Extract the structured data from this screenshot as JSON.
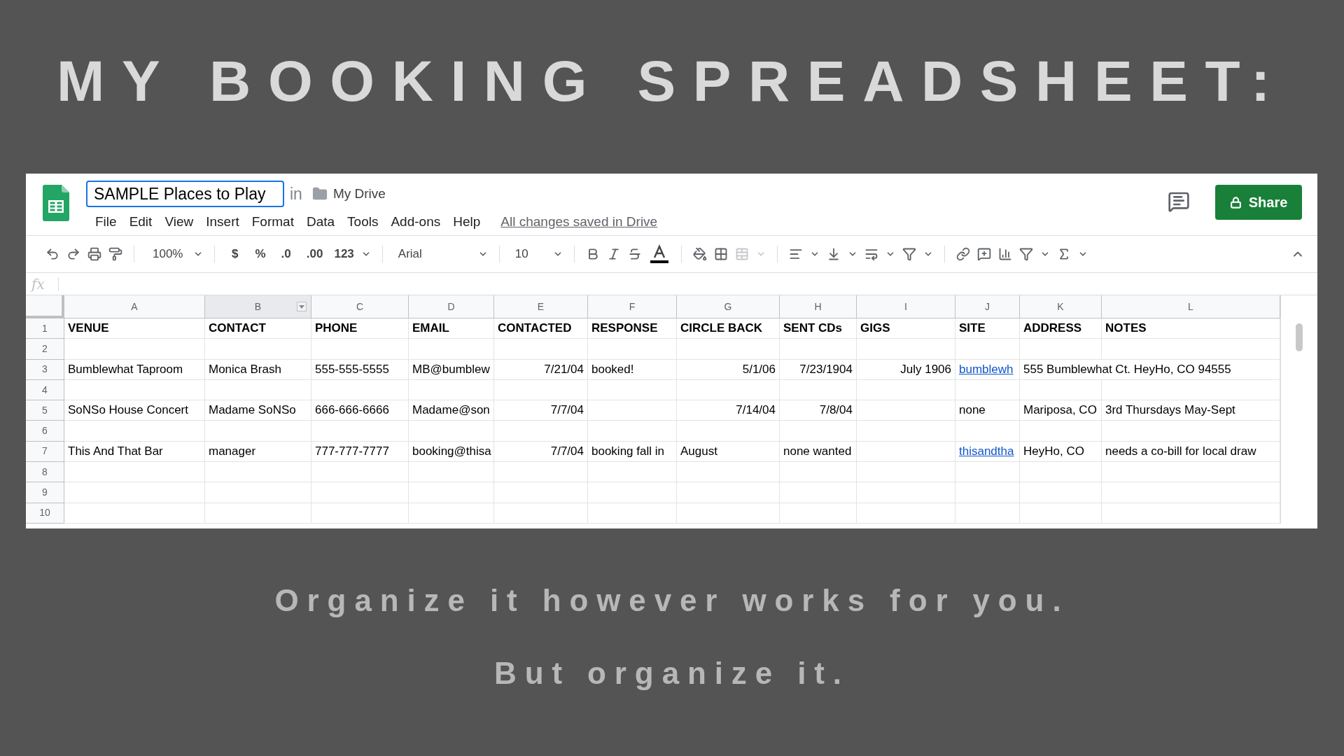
{
  "slide_title": "MY BOOKING SPREADSHEET:",
  "sheet": {
    "doc_title": "SAMPLE Places to Play",
    "location_word": "in",
    "folder": "My Drive",
    "menu": [
      "File",
      "Edit",
      "View",
      "Insert",
      "Format",
      "Data",
      "Tools",
      "Add-ons",
      "Help"
    ],
    "save_status": "All changes saved in Drive",
    "share_button": "Share",
    "toolbar": {
      "zoom": "100%",
      "currency": "$",
      "percent": "%",
      "decrease_decimals": ".0",
      "increase_decimals": ".00",
      "number_format": "123",
      "font": "Arial",
      "font_size": "10"
    },
    "formula_label": "fx",
    "columns": [
      {
        "label": "A",
        "selected": false
      },
      {
        "label": "B",
        "selected": true
      },
      {
        "label": "C",
        "selected": false
      },
      {
        "label": "D",
        "selected": false
      },
      {
        "label": "E",
        "selected": false
      },
      {
        "label": "F",
        "selected": false
      },
      {
        "label": "G",
        "selected": false
      },
      {
        "label": "H",
        "selected": false
      },
      {
        "label": "I",
        "selected": false
      },
      {
        "label": "J",
        "selected": false
      },
      {
        "label": "K",
        "selected": false
      },
      {
        "label": "L",
        "selected": false
      }
    ],
    "header_row": {
      "number": "1",
      "cells": [
        "VENUE",
        "CONTACT",
        "PHONE",
        "EMAIL",
        "CONTACTED",
        "RESPONSE",
        "CIRCLE BACK",
        "SENT CDs",
        "GIGS",
        "SITE",
        "ADDRESS",
        "NOTES"
      ]
    },
    "rows": [
      {
        "number": "2",
        "cells": [
          "",
          "",
          "",
          "",
          "",
          "",
          "",
          "",
          "",
          "",
          "",
          ""
        ]
      },
      {
        "number": "3",
        "cells": [
          "Bumblewhat Taproom",
          "Monica Brash",
          "555-555-5555",
          "MB@bumblew",
          {
            "text": "7/21/04",
            "right_aligned": true
          },
          "booked!",
          {
            "text": "5/1/06",
            "right_aligned": true
          },
          {
            "text": "7/23/1904",
            "right_aligned": true
          },
          {
            "text": "July 1906",
            "right_aligned": true
          },
          {
            "text": "bumblewh",
            "link": true
          },
          {
            "text": "555 Bumblewhat Ct. HeyHo, CO 94555",
            "overflow": true
          },
          ""
        ]
      },
      {
        "number": "4",
        "cells": [
          "",
          "",
          "",
          "",
          "",
          "",
          "",
          "",
          "",
          "",
          "",
          ""
        ]
      },
      {
        "number": "5",
        "cells": [
          "SoNSo House Concert",
          "Madame SoNSo",
          "666-666-6666",
          "Madame@son",
          {
            "text": "7/7/04",
            "right_aligned": true
          },
          "",
          {
            "text": "7/14/04",
            "right_aligned": true
          },
          {
            "text": "7/8/04",
            "right_aligned": true
          },
          "",
          "none",
          "Mariposa, CO",
          "3rd Thursdays May-Sept"
        ]
      },
      {
        "number": "6",
        "cells": [
          "",
          "",
          "",
          "",
          "",
          "",
          "",
          "",
          "",
          "",
          "",
          ""
        ]
      },
      {
        "number": "7",
        "cells": [
          "This And That Bar",
          "manager",
          "777-777-7777",
          "booking@thisa",
          {
            "text": "7/7/04",
            "right_aligned": true
          },
          "booking fall in",
          "August",
          "none wanted",
          "",
          {
            "text": "thisandtha",
            "link": true
          },
          "HeyHo, CO",
          "needs a co-bill for local draw"
        ]
      },
      {
        "number": "8",
        "cells": [
          "",
          "",
          "",
          "",
          "",
          "",
          "",
          "",
          "",
          "",
          "",
          ""
        ]
      },
      {
        "number": "9",
        "cells": [
          "",
          "",
          "",
          "",
          "",
          "",
          "",
          "",
          "",
          "",
          "",
          ""
        ]
      },
      {
        "number": "10",
        "cells": [
          "",
          "",
          "",
          "",
          "",
          "",
          "",
          "",
          "",
          "",
          "",
          ""
        ]
      }
    ]
  },
  "captions": [
    "Organize it however works for you.",
    "But organize it."
  ]
}
